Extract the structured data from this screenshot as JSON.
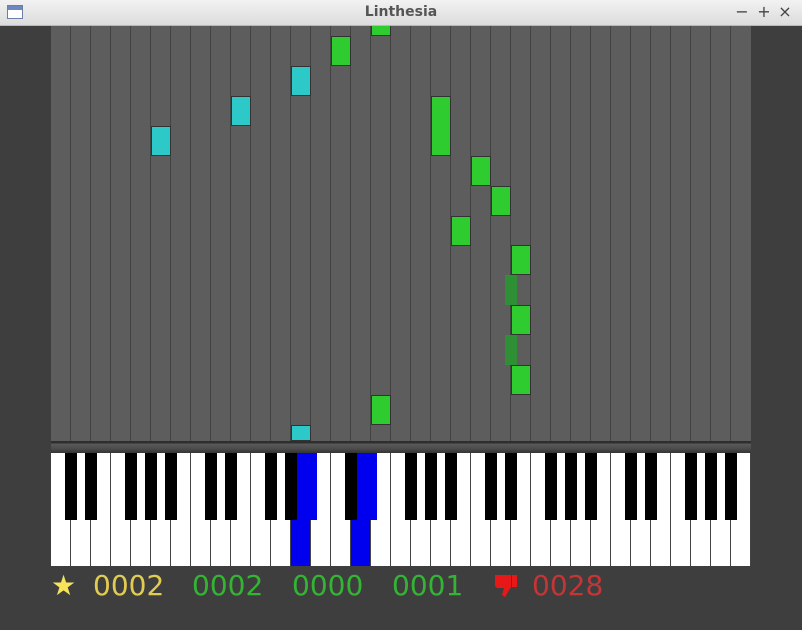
{
  "window": {
    "title": "Linthesia",
    "minimize": "−",
    "maximize": "+",
    "close": "×"
  },
  "lanes": {
    "count": 35
  },
  "notes": [
    {
      "lane": 14,
      "start": 0,
      "len": 1,
      "color": "green"
    },
    {
      "lane": 7,
      "start": 0,
      "len": 1,
      "color": "green"
    },
    {
      "lane": 6,
      "start": 1,
      "len": 1,
      "color": "cyan"
    },
    {
      "lane": 5,
      "start": 2,
      "len": 1,
      "color": "cyan"
    },
    {
      "lane": 4,
      "start": 3,
      "len": 1,
      "color": "cyan"
    },
    {
      "lane": 12,
      "start": 2,
      "len": 2,
      "color": "green"
    },
    {
      "lane": 11,
      "start": 4,
      "len": 1,
      "color": "green"
    },
    {
      "lane": 10,
      "start": 5,
      "len": 1,
      "color": "green"
    },
    {
      "lane": 11,
      "start": 6,
      "len": 1,
      "color": "green"
    },
    {
      "lane": 9,
      "start": 7,
      "len": 1,
      "color": "green"
    },
    {
      "lane": 8,
      "start": 8,
      "len": 1,
      "color": "dark"
    },
    {
      "lane": 9,
      "start": 9,
      "len": 1,
      "color": "green"
    },
    {
      "lane": 8,
      "start": 10,
      "len": 1,
      "color": "dark"
    },
    {
      "lane": 9,
      "start": 11,
      "len": 1,
      "color": "green"
    },
    {
      "lane": 16,
      "start": 12,
      "len": 1,
      "color": "green"
    },
    {
      "lane": 12,
      "start": 13,
      "len": 1,
      "color": "cyan"
    }
  ],
  "keyboard": {
    "white_keys": 35,
    "pressed_white": [
      12,
      15
    ],
    "pressed_black": [
      12,
      15
    ]
  },
  "stats": {
    "star_icon": "star-icon",
    "score": "0002",
    "hits": "0002",
    "good": "0000",
    "ok": "0001",
    "miss_icon": "thumbs-down-icon",
    "misses": "0028"
  },
  "colors": {
    "score": "#e1cc52",
    "green_stats": "#33b533",
    "misses": "#c43535",
    "thumbs": "#e81818"
  }
}
